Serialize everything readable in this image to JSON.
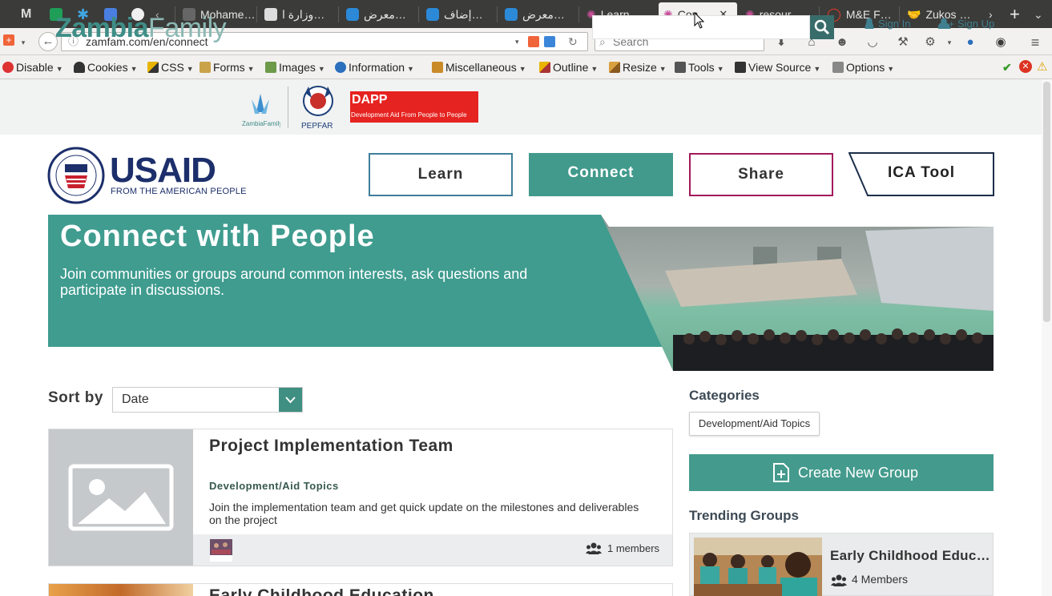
{
  "browser": {
    "tabs": [
      {
        "title": "",
        "icon": "gmail-icon",
        "color": "#d6d6d6"
      },
      {
        "title": "",
        "icon": "sheets-icon",
        "color": "#1e9e57"
      },
      {
        "title": "",
        "icon": "asterisk-icon",
        "color": "#3fa6e0"
      },
      {
        "title": "",
        "icon": "docs-icon",
        "color": "#4a7fe1"
      },
      {
        "title": "",
        "icon": "olx-icon",
        "color": "#f0f0f0"
      },
      {
        "title": "Mohame…",
        "icon": "page-icon",
        "color": "#777"
      },
      {
        "title": "وزارة ا…",
        "icon": "doc-icon",
        "color": "#ddd"
      },
      {
        "title": "معرض…",
        "icon": "circle-icon",
        "color": "#2b89d8"
      },
      {
        "title": "إضاف…",
        "icon": "circle-icon",
        "color": "#2b89d8"
      },
      {
        "title": "معرض…",
        "icon": "circle-icon",
        "color": "#2b89d8"
      },
      {
        "title": "Learn …",
        "icon": "star-icon",
        "color": "#c84f9a"
      },
      {
        "title": "Con…",
        "icon": "star-icon",
        "color": "#c84f9a"
      },
      {
        "title": "resour…",
        "icon": "star-icon",
        "color": "#c84f9a"
      },
      {
        "title": "M&E F…",
        "icon": "opera-icon",
        "color": "#e23d2a"
      },
      {
        "title": "Zukos …",
        "icon": "hands-icon",
        "color": "#aaa"
      }
    ],
    "url": "zamfam.com/en/connect",
    "search_placeholder": "Search"
  },
  "devtools": {
    "items": [
      "Disable",
      "Cookies",
      "CSS",
      "Forms",
      "Images",
      "Information",
      "Miscellaneous",
      "Outline",
      "Resize",
      "Tools",
      "View Source",
      "Options"
    ]
  },
  "header": {
    "brand_main": "Zambia",
    "brand_light": "Family",
    "zambia_family_small": "ZambiaFamily",
    "pepfar": "PEPFAR",
    "dapp_title": "DAPP",
    "dapp_sub": "Development Aid From People to People",
    "sign_in": "Sign In",
    "sign_up": "Sign Up"
  },
  "usaid": {
    "name": "USAID",
    "tagline": "FROM THE AMERICAN PEOPLE"
  },
  "nav": {
    "learn": "Learn",
    "connect": "Connect",
    "share": "Share",
    "ica_tool": "ICA Tool"
  },
  "hero": {
    "title": "Connect with People",
    "subtitle": "Join communities or groups around common interests, ask questions and participate in discussions."
  },
  "sort": {
    "label": "Sort by",
    "value": "Date"
  },
  "groups": [
    {
      "title": "Project Implementation Team",
      "category": "Development/Aid Topics",
      "description": "Join the implementation team and get quick update on the milestones and deliverables on the project",
      "members": "1 members"
    },
    {
      "title": "Early Childhood Education"
    }
  ],
  "sidebar": {
    "categories_heading": "Categories",
    "category_chip": "Development/Aid Topics",
    "create_button": "Create New Group",
    "trending_heading": "Trending Groups",
    "trending": [
      {
        "title": "Early Childhood Educ…",
        "members": "4 Members"
      }
    ]
  },
  "colors": {
    "teal": "#3f9c8f",
    "share_border": "#a3195b",
    "learn_border": "#3f7f9a",
    "ica_border": "#1c2f4a"
  }
}
